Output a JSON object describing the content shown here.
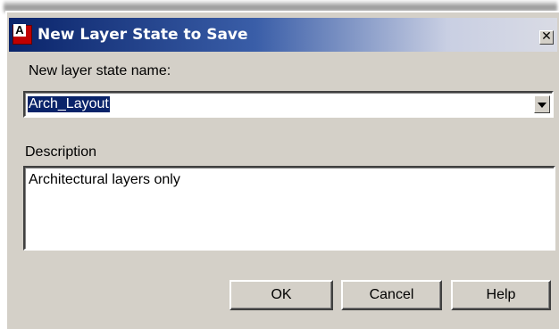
{
  "dialog": {
    "title": "New Layer State to Save",
    "app_icon_letter": "A",
    "close_glyph": "✕"
  },
  "form": {
    "name_label": "New layer state name:",
    "name_value": "Arch_Layout",
    "description_label": "Description",
    "description_value": "Architectural layers only"
  },
  "buttons": {
    "ok": "OK",
    "cancel": "Cancel",
    "help": "Help"
  },
  "colors": {
    "titlebar_start": "#0a246a",
    "dialog_face": "#d4d0c8",
    "selection": "#0a246a"
  },
  "icons": {
    "app": "autocad-app-icon",
    "close": "close-icon",
    "dropdown": "chevron-down-icon"
  }
}
